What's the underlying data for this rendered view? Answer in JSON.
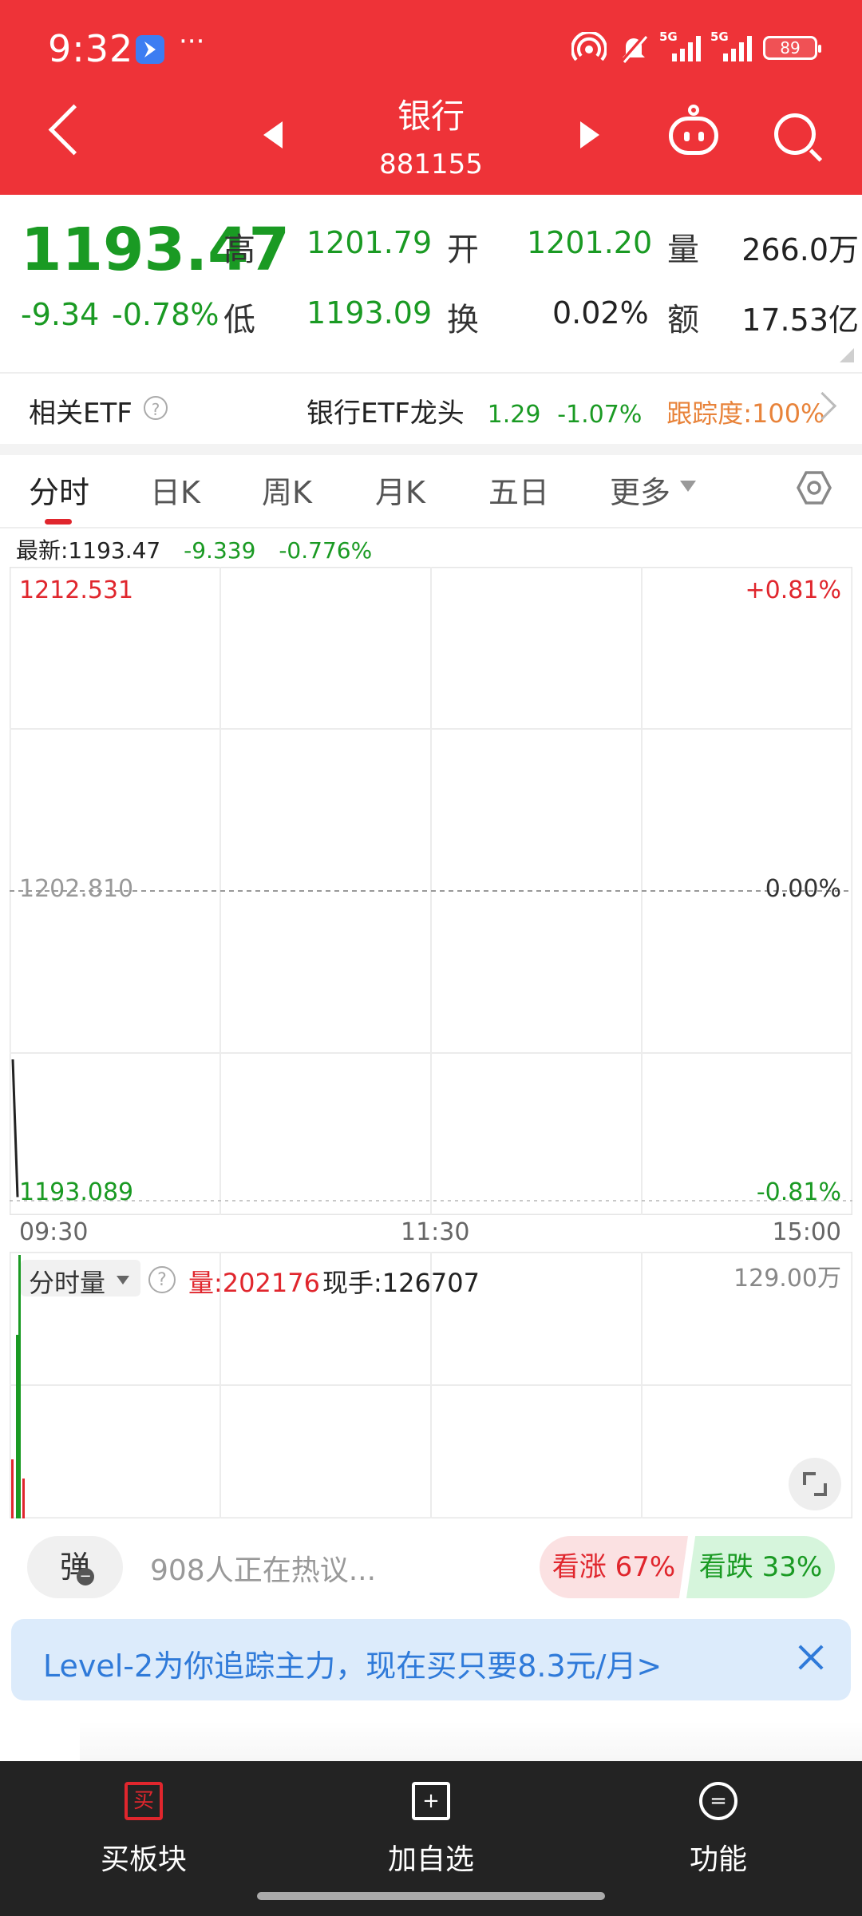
{
  "status_bar": {
    "time": "9:32",
    "more": "···",
    "signal_labels": [
      "5G",
      "5G"
    ],
    "battery": "89"
  },
  "header": {
    "title": "银行",
    "code": "881155"
  },
  "quote": {
    "price": "1193.47",
    "change": "-9.34",
    "change_pct": "-0.78%",
    "high_label": "高",
    "high": "1201.79",
    "open_label": "开",
    "open": "1201.20",
    "volume_label": "量",
    "volume": "266.0万",
    "low_label": "低",
    "low": "1193.09",
    "turnover_label": "换",
    "turnover": "0.02%",
    "amount_label": "额",
    "amount": "17.53亿"
  },
  "etf": {
    "label": "相关ETF",
    "help": "?",
    "name": "银行ETF龙头",
    "price": "1.29",
    "change_pct": "-1.07%",
    "tracking": "跟踪度:100%"
  },
  "tabs": [
    "分时",
    "日K",
    "周K",
    "月K",
    "五日",
    "更多"
  ],
  "chart": {
    "legend": {
      "latest": "最新:1193.47",
      "change": "-9.339",
      "change_pct": "-0.776%"
    },
    "y_top": "1212.531",
    "y_mid": "1202.810",
    "y_bottom": "1193.089",
    "pct_top": "+0.81%",
    "pct_mid": "0.00%",
    "pct_bottom": "-0.81%",
    "x_labels": [
      "09:30",
      "11:30",
      "15:00"
    ]
  },
  "chart_data": {
    "type": "line",
    "x": [
      "09:30",
      "09:31"
    ],
    "series": [
      {
        "values": [
          1197.5,
          1193.2
        ]
      }
    ],
    "ylim": [
      1193.089,
      1212.531
    ],
    "xlim_labels": [
      "09:30",
      "11:30",
      "15:00"
    ],
    "grid": true
  },
  "volume": {
    "label": "分时量",
    "qty": "量:202176",
    "hand": "现手:126707",
    "max": "129.00万"
  },
  "discuss": {
    "danmu": "弹",
    "text": "908人正在热议...",
    "bull": "看涨 67%",
    "bear": "看跌 33%"
  },
  "banner": {
    "text": "Level-2为你追踪主力，现在买只要8.3元/月>"
  },
  "bottom_nav": [
    {
      "icon": "买",
      "label": "买板块"
    },
    {
      "icon": "+",
      "label": "加自选"
    },
    {
      "icon": "=",
      "label": "功能"
    }
  ],
  "colors": {
    "header": "#ee3338",
    "up": "#e0262d",
    "down": "#1a9a23",
    "banner": "#dcebfb"
  }
}
